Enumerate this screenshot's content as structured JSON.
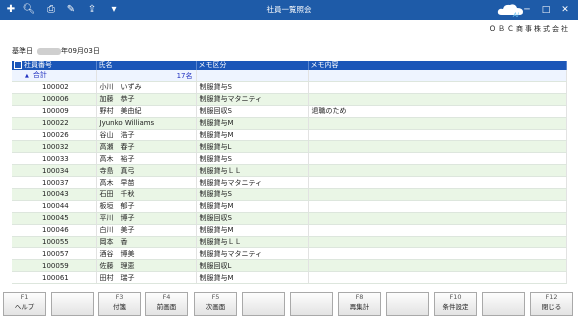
{
  "window": {
    "title": "社員一覧照会"
  },
  "toolbar": {
    "icons": [
      "add-icon",
      "zoom-icon",
      "print-icon",
      "tools-icon",
      "export-icon",
      "dropdown-icon"
    ]
  },
  "company": "ＯＢＣ商事株式会社",
  "reference_date": {
    "label": "基準日",
    "value": "年09月03日"
  },
  "grid": {
    "columns": [
      "社員番号",
      "氏名",
      "メモ区分",
      "メモ内容"
    ],
    "total": {
      "label": "合計",
      "count": "17名"
    },
    "rows": [
      [
        "100002",
        "小川　いずみ",
        "制服貸与S",
        ""
      ],
      [
        "100006",
        "加藤　恭子",
        "制服貸与マタニティ",
        ""
      ],
      [
        "100009",
        "野村　美由紀",
        "制服回収S",
        "退職のため"
      ],
      [
        "100022",
        "Jyunko Williams",
        "制服貸与M",
        ""
      ],
      [
        "100026",
        "谷山　浩子",
        "制服貸与M",
        ""
      ],
      [
        "100032",
        "高瀬　春子",
        "制服貸与L",
        ""
      ],
      [
        "100033",
        "高木　裕子",
        "制服貸与S",
        ""
      ],
      [
        "100034",
        "寺島　真弓",
        "制服貸与ＬＬ",
        ""
      ],
      [
        "100037",
        "高木　早苗",
        "制服貸与マタニティ",
        ""
      ],
      [
        "100043",
        "石田　千秋",
        "制服貸与S",
        ""
      ],
      [
        "100044",
        "板垣　郁子",
        "制服貸与M",
        ""
      ],
      [
        "100045",
        "平川　博子",
        "制服回収S",
        ""
      ],
      [
        "100046",
        "白川　美子",
        "制服貸与M",
        ""
      ],
      [
        "100055",
        "岡本　香",
        "制服貸与ＬＬ",
        ""
      ],
      [
        "100057",
        "酒谷　博美",
        "制服貸与マタニティ",
        ""
      ],
      [
        "100059",
        "佐藤　理恵",
        "制服回収L",
        ""
      ],
      [
        "100061",
        "田村　瑞子",
        "制服貸与M",
        ""
      ]
    ]
  },
  "fkeys": [
    {
      "key": "F1",
      "label": "ヘルプ"
    },
    {
      "key": "",
      "label": ""
    },
    {
      "key": "F3",
      "label": "付箋"
    },
    {
      "key": "F4",
      "label": "前画面"
    },
    {
      "key": "F5",
      "label": "次画面"
    },
    {
      "key": "",
      "label": ""
    },
    {
      "key": "",
      "label": ""
    },
    {
      "key": "F8",
      "label": "再集計"
    },
    {
      "key": "",
      "label": ""
    },
    {
      "key": "F10",
      "label": "条件設定"
    },
    {
      "key": "",
      "label": ""
    },
    {
      "key": "F12",
      "label": "閉じる"
    }
  ]
}
